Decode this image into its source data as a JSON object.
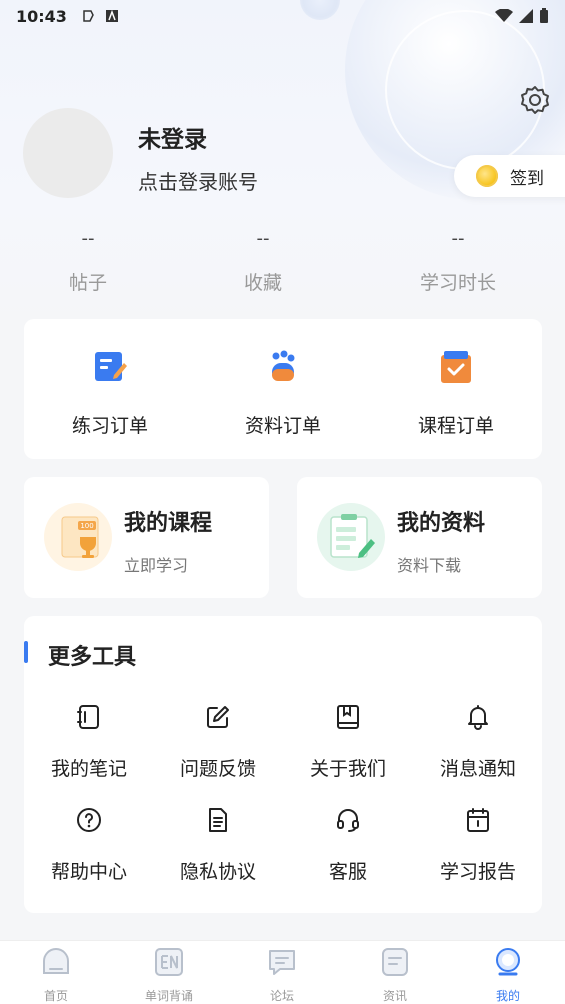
{
  "status_bar": {
    "time": "10:43"
  },
  "profile": {
    "name": "未登录",
    "login_prompt": "点击登录账号"
  },
  "checkin": {
    "label": "签到"
  },
  "stats": [
    {
      "value": "--",
      "label": "帖子"
    },
    {
      "value": "--",
      "label": "收藏"
    },
    {
      "value": "--",
      "label": "学习时长"
    }
  ],
  "orders": [
    {
      "label": "练习订单",
      "icon": "practice-order-icon"
    },
    {
      "label": "资料订单",
      "icon": "material-order-icon"
    },
    {
      "label": "课程订单",
      "icon": "course-order-icon"
    }
  ],
  "features": {
    "courses": {
      "title": "我的课程",
      "subtitle": "立即学习"
    },
    "materials": {
      "title": "我的资料",
      "subtitle": "资料下载"
    }
  },
  "tools": {
    "title": "更多工具",
    "items": [
      {
        "label": "我的笔记",
        "icon": "notebook-icon"
      },
      {
        "label": "问题反馈",
        "icon": "edit-icon"
      },
      {
        "label": "关于我们",
        "icon": "book-icon"
      },
      {
        "label": "消息通知",
        "icon": "bell-icon"
      },
      {
        "label": "帮助中心",
        "icon": "question-icon"
      },
      {
        "label": "隐私协议",
        "icon": "document-icon"
      },
      {
        "label": "客服",
        "icon": "headset-icon"
      },
      {
        "label": "学习报告",
        "icon": "calendar-icon"
      }
    ]
  },
  "tabbar": [
    {
      "label": "首页",
      "icon": "home-icon"
    },
    {
      "label": "单词背诵",
      "icon": "en-icon"
    },
    {
      "label": "论坛",
      "icon": "forum-icon"
    },
    {
      "label": "资讯",
      "icon": "news-icon"
    },
    {
      "label": "我的",
      "icon": "profile-icon",
      "active": true
    }
  ],
  "colors": {
    "accent": "#3a7bf0",
    "order_blue": "#3a7bf0",
    "order_orange": "#f08a3c"
  }
}
